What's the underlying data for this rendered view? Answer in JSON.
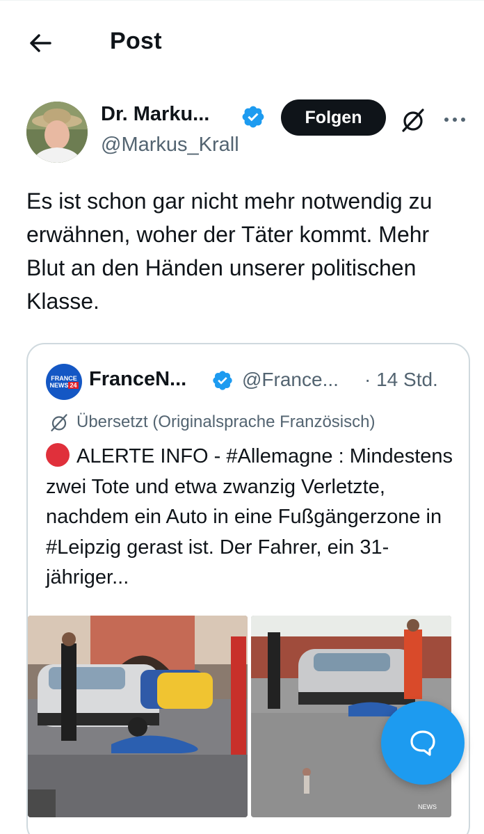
{
  "header": {
    "title": "Post",
    "back_icon": "arrow-left-icon"
  },
  "author": {
    "name": "Dr. Marku...",
    "handle": "@Markus_Krall",
    "verified_icon": "verified-badge-icon",
    "follow_label": "Folgen",
    "grok_icon": "grok-icon",
    "more_icon": "more-horizontal-icon"
  },
  "post": {
    "text": "Es ist schon gar nicht mehr notwendig zu erwähnen, woher der Täter kommt. Mehr Blut an den Händen unserer politischen Klasse."
  },
  "quote": {
    "avatar_line1": "FRANCE",
    "avatar_line2": "NEWS",
    "avatar_line3": "24",
    "name": "FranceN...",
    "handle": "@France...",
    "time": "· 14 Std.",
    "translated_label": "Übersetzt (Originalsprache Französisch)",
    "text": "ALERTE INFO - #Allemagne : Mindestens zwei Tote und etwa zwanzig Verletzte, nachdem ein Auto in eine Fußgängerzone in #Leipzig gerast ist. Der Fahrer, ein 31-jähriger...",
    "media_count": 2
  },
  "fab": {
    "icon": "reply-bubble-icon"
  },
  "colors": {
    "accent": "#1d9bf0",
    "text": "#0f1419",
    "secondary": "#536471",
    "border": "#cfd9de",
    "follow_bg": "#0f1419",
    "alert_red": "#e0303b"
  }
}
